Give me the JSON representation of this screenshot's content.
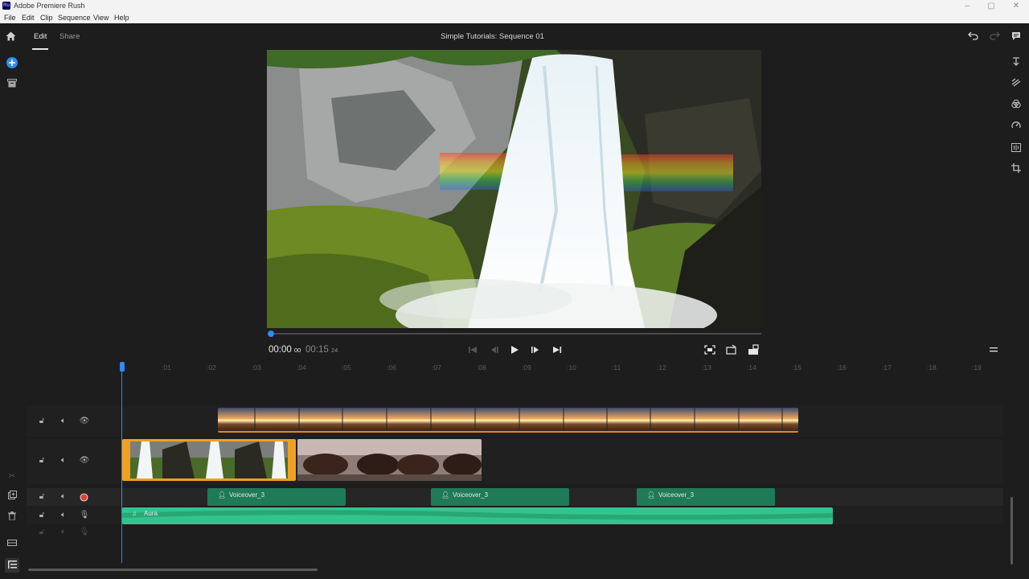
{
  "window": {
    "app_title": "Adobe Premiere Rush",
    "app_icon_text": "Ru",
    "controls": {
      "minimize": "–",
      "maximize": "▢",
      "close": "✕"
    }
  },
  "menu": {
    "file": "File",
    "edit": "Edit",
    "clip": "Clip",
    "sequence": "Sequence",
    "view": "View",
    "help": "Help"
  },
  "header": {
    "tabs": {
      "edit": "Edit",
      "share": "Share"
    },
    "sequence_title": "Simple Tutorials: Sequence 01",
    "icons": {
      "home": "home-icon",
      "undo": "undo-icon",
      "redo": "redo-icon",
      "comments": "comments-icon"
    }
  },
  "left_toolbar": {
    "add_icon": "plus-circle-icon",
    "media_icon": "media-bin-icon",
    "scissors_icon": "scissors-icon",
    "duplicate_icon": "duplicate-icon",
    "delete_icon": "trash-icon",
    "track_icon": "track-controls-icon",
    "list_icon": "list-icon"
  },
  "right_toolbar": {
    "titles": "titles-icon",
    "transitions": "transitions-icon",
    "color": "color-icon",
    "speed": "speed-icon",
    "audio": "audio-icon",
    "transform": "crop-transform-icon"
  },
  "player": {
    "current_time": "00:00",
    "current_frames": "00",
    "duration_time": "00:15",
    "duration_frames": "24",
    "progress": 0.0,
    "icons": {
      "go_start": "go-to-start-icon",
      "step_back": "step-back-icon",
      "play": "play-icon",
      "step_forward": "step-forward-icon",
      "go_end": "go-to-end-icon",
      "fit": "fit-frame-icon",
      "rotate": "rotate-icon",
      "aspect": "aspect-ratio-icon",
      "menu": "menu-icon"
    }
  },
  "timeline": {
    "ticks": [
      ":01",
      ":02",
      ":03",
      ":04",
      ":05",
      ":06",
      ":07",
      ":08",
      ":09",
      ":10",
      ":11",
      ":12",
      ":13",
      ":14",
      ":15",
      ":16",
      ":17",
      ":18",
      ":19"
    ],
    "voiceover_clips": [
      "Voiceover_3",
      "Voiceover_3",
      "Voiceover_3"
    ],
    "music_clip": "Aura",
    "colors": {
      "accent": "#2d8cf0",
      "audio": "#34c38f",
      "voiceover": "#1f7a57",
      "selected": "#f0a020",
      "record": "#e03c3c"
    }
  }
}
